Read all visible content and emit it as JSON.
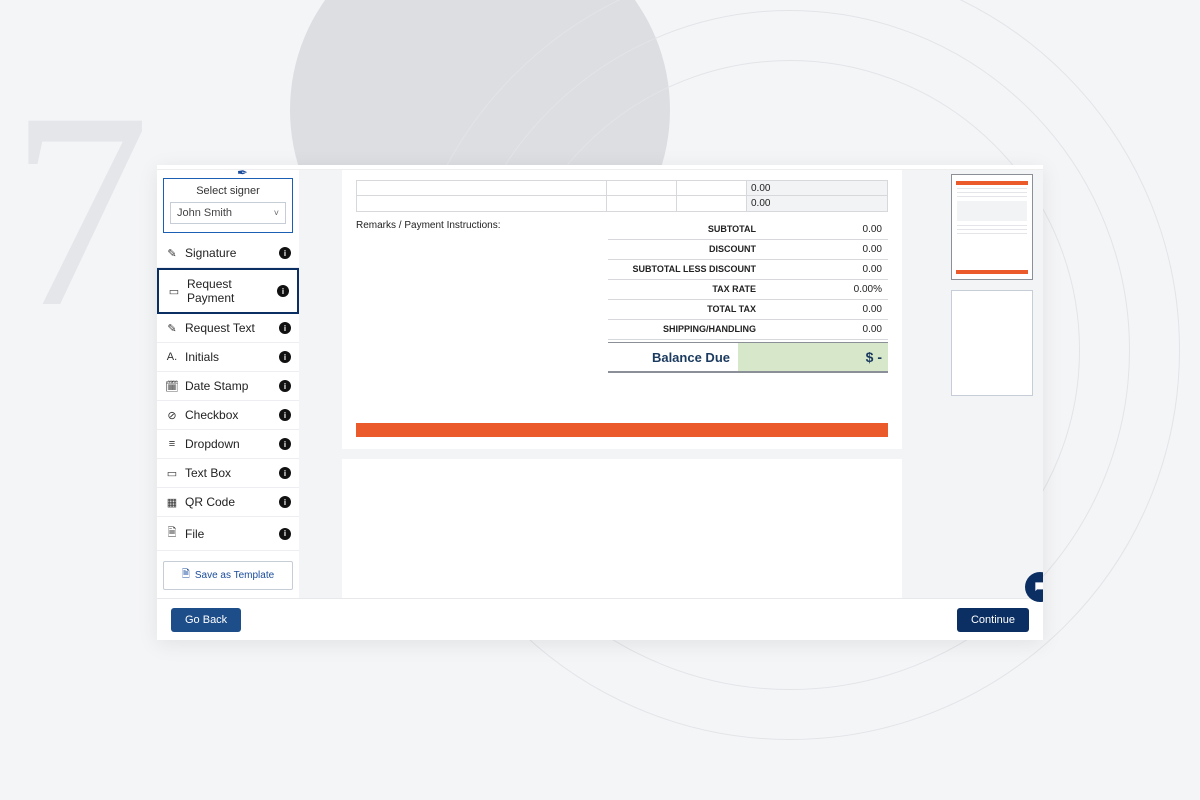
{
  "background": {
    "glyph": "7"
  },
  "sidebar": {
    "signer_label": "Select signer",
    "signer_value": "John Smith",
    "fields": [
      {
        "icon": "signature-icon",
        "glyph": "✎",
        "label": "Signature"
      },
      {
        "icon": "request-payment-icon",
        "glyph": "▭",
        "label": "Request Payment"
      },
      {
        "icon": "request-text-icon",
        "glyph": "✎",
        "label": "Request Text"
      },
      {
        "icon": "initials-icon",
        "glyph": "A.",
        "label": "Initials"
      },
      {
        "icon": "date-stamp-icon",
        "glyph": "🗓",
        "label": "Date Stamp"
      },
      {
        "icon": "checkbox-icon",
        "glyph": "⊘",
        "label": "Checkbox"
      },
      {
        "icon": "dropdown-icon",
        "glyph": "≡",
        "label": "Dropdown"
      },
      {
        "icon": "text-box-icon",
        "glyph": "▭",
        "label": "Text Box"
      },
      {
        "icon": "qr-code-icon",
        "glyph": "▦",
        "label": "QR Code"
      },
      {
        "icon": "file-icon",
        "glyph": "🗎",
        "label": "File"
      }
    ],
    "selected_index": 1,
    "save_template_label": "Save as Template"
  },
  "document": {
    "item_rows": [
      {
        "amount": "0.00"
      },
      {
        "amount": "0.00"
      }
    ],
    "remarks_label": "Remarks / Payment Instructions:",
    "totals": [
      {
        "label": "SUBTOTAL",
        "value": "0.00"
      },
      {
        "label": "DISCOUNT",
        "value": "0.00"
      },
      {
        "label": "SUBTOTAL LESS DISCOUNT",
        "value": "0.00"
      },
      {
        "label": "TAX RATE",
        "value": "0.00%"
      },
      {
        "label": "TOTAL TAX",
        "value": "0.00"
      },
      {
        "label": "SHIPPING/HANDLING",
        "value": "0.00"
      }
    ],
    "balance_label": "Balance Due",
    "balance_value": "$ -"
  },
  "footer": {
    "back_label": "Go Back",
    "continue_label": "Continue"
  }
}
